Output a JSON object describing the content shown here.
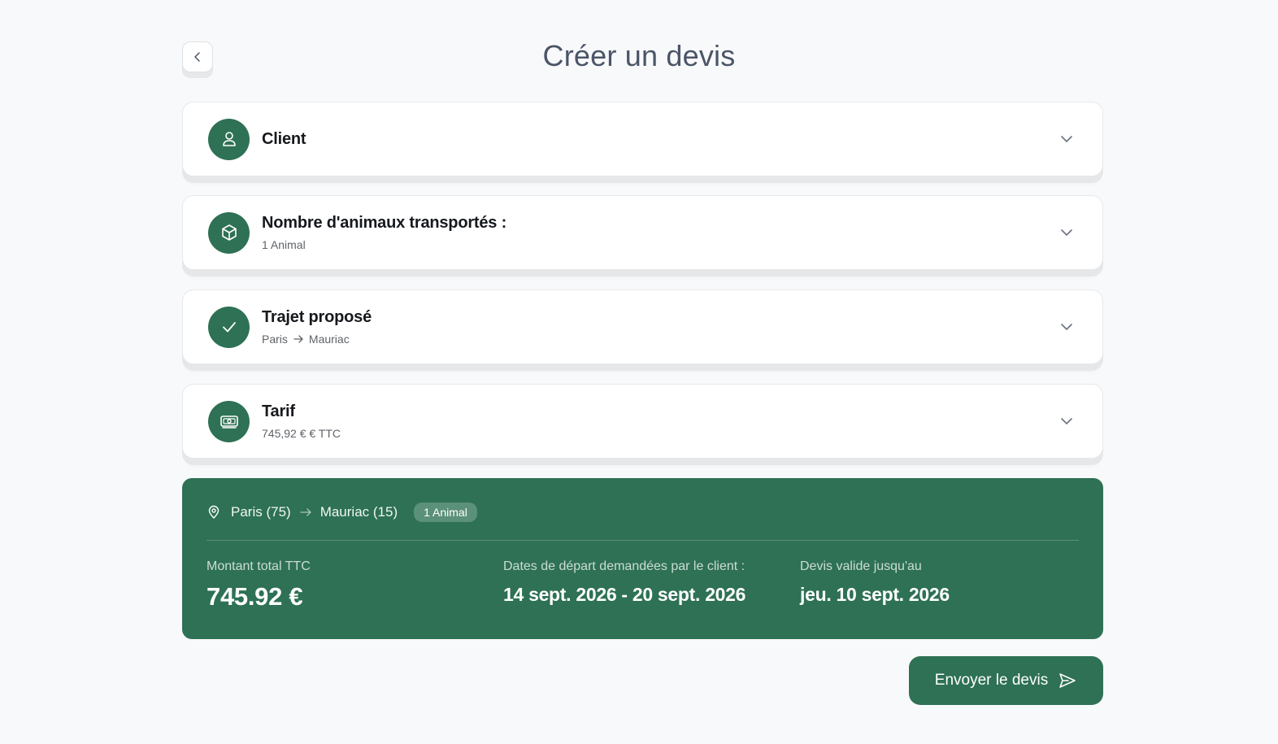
{
  "page": {
    "title": "Créer un devis",
    "back_icon": "chevron-left-icon"
  },
  "sections": [
    {
      "title": "Client",
      "subtitle": "",
      "icon": "user-icon"
    },
    {
      "title": "Nombre d'animaux transportés :",
      "subtitle": "1 Animal",
      "icon": "box-icon"
    },
    {
      "title": "Trajet proposé",
      "subtitle_from": "Paris",
      "subtitle_to": "Mauriac",
      "icon": "check-icon"
    },
    {
      "title": "Tarif",
      "subtitle": "745,92 € € TTC",
      "icon": "banknote-icon"
    }
  ],
  "summary": {
    "from": "Paris (75)",
    "to": "Mauriac (15)",
    "badge": "1 Animal",
    "total_label": "Montant total TTC",
    "total_value": "745.92 €",
    "dates_label": "Dates de départ demandées par le client :",
    "dates_value": "14 sept. 2026 - 20 sept. 2026",
    "valid_label": "Devis valide jusqu'au",
    "valid_value": "jeu. 10 sept. 2026"
  },
  "actions": {
    "send_label": "Envoyer le devis"
  },
  "colors": {
    "primary": "#2e7155",
    "background": "#f8f9fa",
    "card": "#ffffff"
  }
}
